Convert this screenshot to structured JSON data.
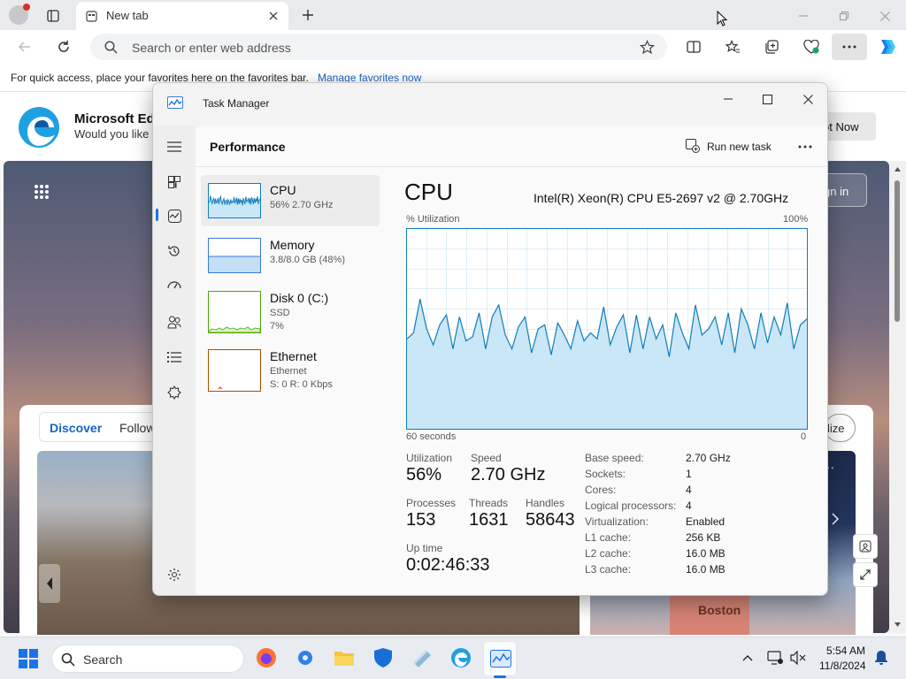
{
  "browser": {
    "tab_title": "New tab",
    "address_placeholder": "Search or enter web address",
    "favbar_text": "For quick access, place your favorites here on the favorites bar.",
    "favbar_link": "Manage favorites now",
    "banner_title": "Microsoft Edg",
    "banner_sub": "Would you like t",
    "banner_btn": "ot Now",
    "signin": "gn in",
    "feed_tabs": [
      "Discover",
      "Follow"
    ],
    "personalize": "lize",
    "city_label": "Boston"
  },
  "task_manager": {
    "title": "Task Manager",
    "section": "Performance",
    "run_new_task": "Run new task",
    "resources": [
      {
        "name": "CPU",
        "detail": "56%  2.70 GHz",
        "detail2": ""
      },
      {
        "name": "Memory",
        "detail": "3.8/8.0 GB (48%)",
        "detail2": ""
      },
      {
        "name": "Disk 0 (C:)",
        "detail": "SSD",
        "detail2": "7%"
      },
      {
        "name": "Ethernet",
        "detail": "Ethernet",
        "detail2": "S: 0  R: 0 Kbps"
      }
    ],
    "cpu_title": "CPU",
    "cpu_model": "Intel(R) Xeon(R) CPU E5-2697 v2 @ 2.70GHz",
    "graph_ylabel": "% Utilization",
    "graph_ymax": "100%",
    "graph_xlabel": "60 seconds",
    "graph_xmin": "0",
    "chart_data": {
      "type": "area",
      "x_range_seconds": [
        60,
        0
      ],
      "ylim": [
        0,
        100
      ],
      "values": [
        45,
        48,
        65,
        50,
        42,
        52,
        57,
        40,
        56,
        44,
        46,
        58,
        40,
        56,
        62,
        47,
        40,
        51,
        56,
        38,
        50,
        52,
        37,
        53,
        47,
        40,
        54,
        44,
        48,
        45,
        61,
        42,
        51,
        57,
        38,
        57,
        40,
        56,
        45,
        52,
        36,
        58,
        48,
        40,
        62,
        47,
        50,
        56,
        42,
        58,
        38,
        60,
        52,
        40,
        58,
        43,
        56,
        47,
        63,
        40,
        52,
        55
      ]
    },
    "stats": {
      "utilization_label": "Utilization",
      "utilization": "56%",
      "speed_label": "Speed",
      "speed": "2.70 GHz",
      "processes_label": "Processes",
      "processes": "153",
      "threads_label": "Threads",
      "threads": "1631",
      "handles_label": "Handles",
      "handles": "58643",
      "uptime_label": "Up time",
      "uptime": "0:02:46:33"
    },
    "details": [
      {
        "k": "Base speed:",
        "v": "2.70 GHz"
      },
      {
        "k": "Sockets:",
        "v": "1"
      },
      {
        "k": "Cores:",
        "v": "4"
      },
      {
        "k": "Logical processors:",
        "v": "4"
      },
      {
        "k": "Virtualization:",
        "v": "Enabled"
      },
      {
        "k": "L1 cache:",
        "v": "256 KB"
      },
      {
        "k": "L2 cache:",
        "v": "16.0 MB"
      },
      {
        "k": "L3 cache:",
        "v": "16.0 MB"
      }
    ]
  },
  "taskbar": {
    "search": "Search",
    "time": "5:54 AM",
    "date": "11/8/2024"
  },
  "colors": {
    "accent": "#1a73e8",
    "cpu_line": "#117dbb",
    "cpu_fill": "#c9e7f6",
    "memory_line": "#8b12ae",
    "disk_line": "#4da60c",
    "ethernet_line": "#a74f01"
  }
}
